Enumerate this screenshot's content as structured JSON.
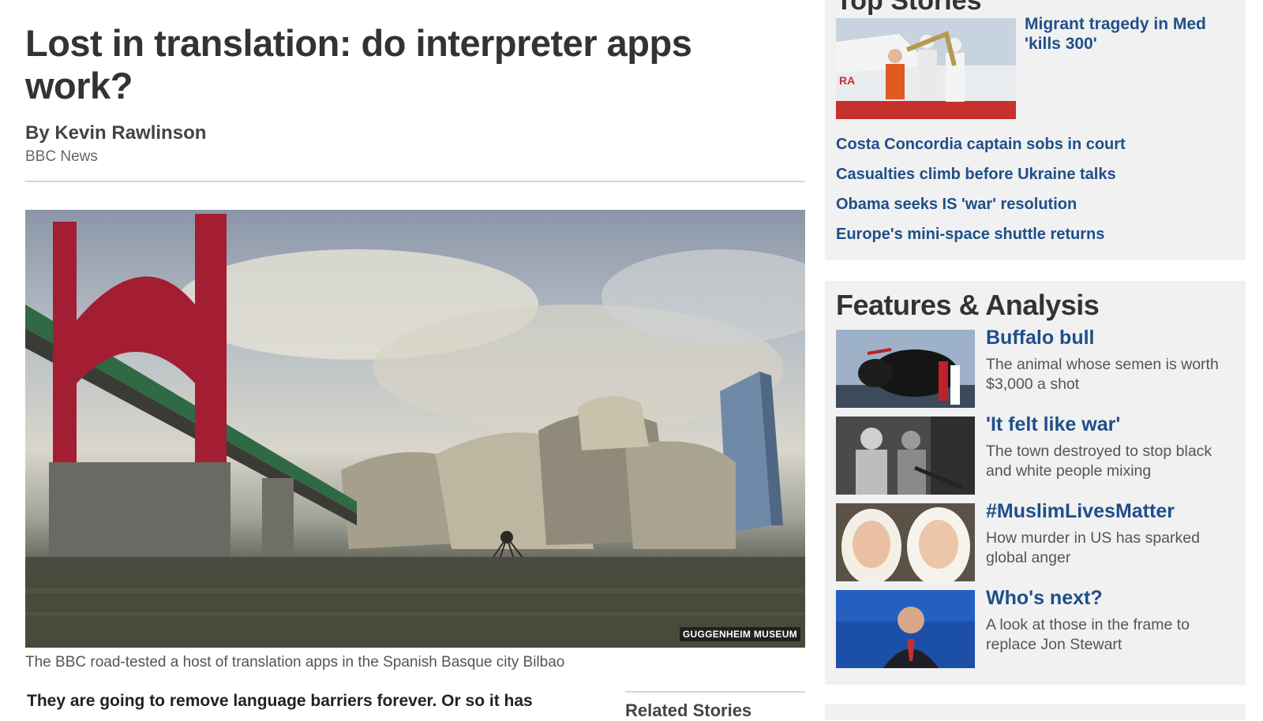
{
  "article": {
    "headline": "Lost in translation: do interpreter apps work?",
    "byline_name": "By Kevin Rawlinson",
    "byline_org": "BBC News",
    "image_credit": "GUGGENHEIM MUSEUM",
    "caption": "The BBC road-tested a host of translation apps in the Spanish Basque city Bilbao",
    "lede": "They are going to remove language barriers forever. Or so it has",
    "related_title": "Related Stories"
  },
  "top_stories": {
    "heading": "Top Stories",
    "lead": "Migrant tragedy in Med 'kills 300'",
    "items": [
      "Costa Concordia captain sobs in court",
      "Casualties climb before Ukraine talks",
      "Obama seeks IS 'war' resolution",
      "Europe's mini-space shuttle returns"
    ]
  },
  "features": {
    "heading": "Features & Analysis",
    "items": [
      {
        "title": "Buffalo bull",
        "desc": "The animal whose semen is worth $3,000 a shot"
      },
      {
        "title": "'It felt like war'",
        "desc": "The town destroyed to stop black and white people mixing"
      },
      {
        "title": "#MuslimLivesMatter",
        "desc": "How murder in US has sparked global anger"
      },
      {
        "title": "Who's next?",
        "desc": "A look at those in the frame to replace Jon Stewart"
      }
    ]
  },
  "colors": {
    "link": "#1f4f8a",
    "sidebar_bg": "#f1f1f1",
    "text": "#333333"
  }
}
